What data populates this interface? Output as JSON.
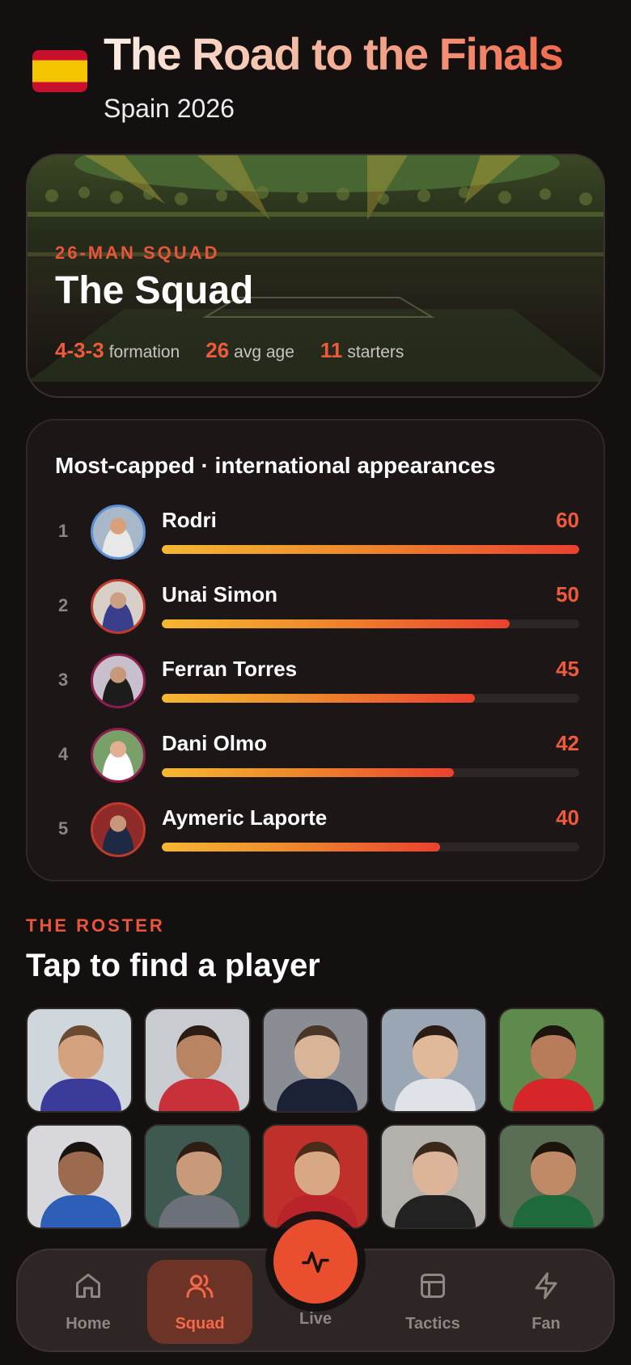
{
  "header": {
    "title": "The Road to the Finals",
    "subtitle": "Spain 2026",
    "flag_colors": [
      "#c8102e",
      "#f4c400"
    ]
  },
  "hero": {
    "eyebrow": "26-MAN SQUAD",
    "title": "The Squad",
    "stats": [
      {
        "value": "4-3-3",
        "label": "formation"
      },
      {
        "value": "26",
        "label": "avg age"
      },
      {
        "value": "11",
        "label": "starters"
      }
    ]
  },
  "most_capped": {
    "title": "Most-capped · international appearances",
    "max": 60,
    "players": [
      {
        "rank": "1",
        "name": "Rodri",
        "caps": 60,
        "caps_label": "60",
        "ring": "#5b8fd6",
        "skin": "#d9a07c",
        "shirt": "#e8e8e8",
        "bg": "#a8b8c8"
      },
      {
        "rank": "2",
        "name": "Unai Simon",
        "caps": 50,
        "caps_label": "50",
        "ring": "#c0392b",
        "skin": "#caa084",
        "shirt": "#3a3f8c",
        "bg": "#d8d0c8"
      },
      {
        "rank": "3",
        "name": "Ferran Torres",
        "caps": 45,
        "caps_label": "45",
        "ring": "#8e1d4e",
        "skin": "#c8987a",
        "shirt": "#1c1c1c",
        "bg": "#c8c0cc"
      },
      {
        "rank": "4",
        "name": "Dani Olmo",
        "caps": 42,
        "caps_label": "42",
        "ring": "#8e1d4e",
        "skin": "#e0b090",
        "shirt": "#ffffff",
        "bg": "#7aa06a"
      },
      {
        "rank": "5",
        "name": "Aymeric Laporte",
        "caps": 40,
        "caps_label": "40",
        "ring": "#c0392b",
        "skin": "#c8967a",
        "shirt": "#1e2a44",
        "bg": "#8e2a2a"
      }
    ]
  },
  "roster": {
    "eyebrow": "THE ROSTER",
    "title": "Tap to find a player",
    "tiles": [
      {
        "bg": "#cfd6dc",
        "skin": "#d4a27e",
        "shirt": "#3b3c9a",
        "hair": "#6a4a30"
      },
      {
        "bg": "#c8ccd0",
        "skin": "#b88462",
        "shirt": "#c8303a",
        "hair": "#2a1c14"
      },
      {
        "bg": "#8a8e94",
        "skin": "#d8b498",
        "shirt": "#1c2236",
        "hair": "#4a3626"
      },
      {
        "bg": "#9aa6b4",
        "skin": "#e0b89a",
        "shirt": "#dfe2e8",
        "hair": "#2a1c14"
      },
      {
        "bg": "#5f8a4e",
        "skin": "#b87c5a",
        "shirt": "#d6262a",
        "hair": "#1e140e"
      },
      {
        "bg": "#d8d8dc",
        "skin": "#9c6a4e",
        "shirt": "#2e5fb8",
        "hair": "#1a1410"
      },
      {
        "bg": "#3e5a50",
        "skin": "#c89a7a",
        "shirt": "#6c7078",
        "hair": "#2c1e14"
      },
      {
        "bg": "#c0302a",
        "skin": "#d8a884",
        "shirt": "#b8242a",
        "hair": "#4a2c18"
      },
      {
        "bg": "#b4b0ac",
        "skin": "#dcb49a",
        "shirt": "#222222",
        "hair": "#3a281a"
      },
      {
        "bg": "#5a6e56",
        "skin": "#c08a66",
        "shirt": "#1e6a3a",
        "hair": "#1e140e"
      }
    ]
  },
  "nav": {
    "items": [
      {
        "label": "Home",
        "icon": "home-icon"
      },
      {
        "label": "Squad",
        "icon": "users-icon",
        "active": true
      },
      {
        "label": "Live",
        "icon": "pulse-icon"
      },
      {
        "label": "Tactics",
        "icon": "layout-icon"
      },
      {
        "label": "Fan",
        "icon": "bolt-icon"
      }
    ]
  },
  "colors": {
    "accent": "#e94e2e",
    "background": "#141010",
    "card": "#1c1716"
  }
}
